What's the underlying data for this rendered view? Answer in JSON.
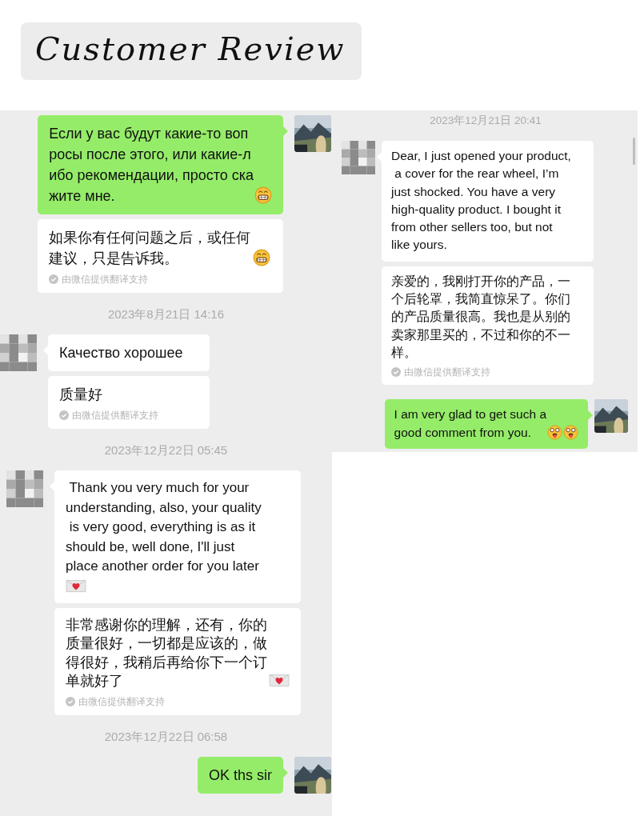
{
  "header": {
    "title": "Customer Review"
  },
  "panels": [
    {
      "messages": [
        {
          "kind": "outgoing",
          "avatar": {
            "kind": "picture"
          },
          "bubbles": [
            {
              "text": "Если у вас будут какие-то воп\nросы после этого, или какие-л\nибо рекомендации, просто ска\nжите мне.",
              "icons": [
                {
                  "kind": "grin"
                }
              ]
            },
            {
              "text": "如果你有任何问题之后，或任何建议，只是告诉我。",
              "icons": [
                {
                  "kind": "grin"
                }
              ],
              "note": "由微信提供翻译支持"
            }
          ]
        },
        {
          "kind": "time",
          "text": "2023年8月21日 14:16"
        },
        {
          "kind": "incoming",
          "avatar": {
            "kind": "picture"
          },
          "bubbles": [
            {
              "text": "Качество хорошее"
            },
            {
              "text": "质量好",
              "note": "由微信提供翻译支持"
            }
          ]
        },
        {
          "kind": "time",
          "text": "2023年12月22日 05:45"
        },
        {
          "kind": "incoming",
          "avatar": {
            "kind": "picture"
          },
          "bubbles": [
            {
              "text": " Thank you very much for your\nunderstanding, also, your quality\n is very good, everything is as it\nshould be, well done, I'll just\nplace another order for you later",
              "icons": [
                {
                  "kind": "heart-letter"
                }
              ],
              "icons_on_new_line": true
            },
            {
              "text": "非常感谢你的理解，还有，你的质量很好，一切都是应该的，做得很好，我稍后再给你下一个订单就好了",
              "icons": [
                {
                  "kind": "heart-letter"
                }
              ],
              "note": "由微信提供翻译支持"
            }
          ]
        },
        {
          "kind": "time",
          "text": "2023年12月22日 06:58"
        },
        {
          "kind": "outgoing",
          "avatar": {
            "kind": "picture"
          },
          "bubbles": [
            {
              "text": "OK ths sir"
            }
          ]
        }
      ]
    },
    {
      "messages": [
        {
          "kind": "time",
          "text": "2023年12月21日 20:41"
        },
        {
          "kind": "incoming",
          "avatar": {
            "kind": "picture"
          },
          "bubbles": [
            {
              "text": "Dear, I just opened your product,\n a cover for the rear wheel, I’m\njust shocked. You have a very\nhigh-quality product. I bought it\nfrom other sellers too, but not\nlike yours."
            },
            {
              "text": "亲爱的，我刚打开你的产品，一个后轮罩，我简直惊呆了。你们的产品质量很高。我也是从别的卖家那里买的，不过和你的不一样。",
              "note": "由微信提供翻译支持"
            }
          ]
        },
        {
          "kind": "outgoing",
          "avatar": {
            "kind": "picture"
          },
          "bubbles": [
            {
              "text": "I am very glad to get such a\ngood comment from you.",
              "icons": [
                {
                  "kind": "tongue"
                },
                {
                  "kind": "tongue"
                }
              ]
            }
          ]
        }
      ]
    }
  ]
}
